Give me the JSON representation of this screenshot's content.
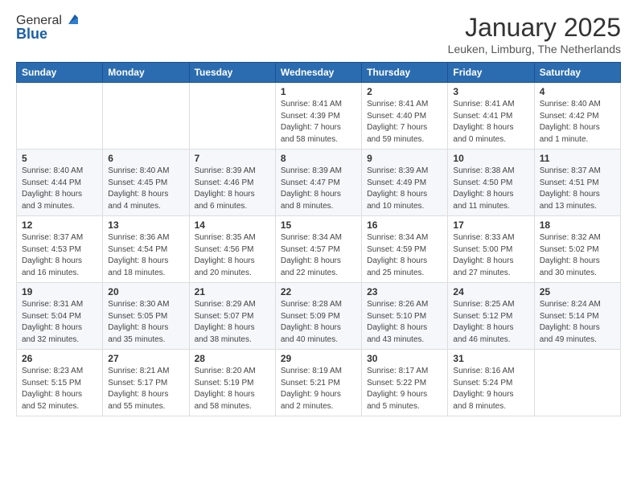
{
  "header": {
    "logo_general": "General",
    "logo_blue": "Blue",
    "month": "January 2025",
    "location": "Leuken, Limburg, The Netherlands"
  },
  "weekdays": [
    "Sunday",
    "Monday",
    "Tuesday",
    "Wednesday",
    "Thursday",
    "Friday",
    "Saturday"
  ],
  "weeks": [
    [
      {
        "day": "",
        "info": ""
      },
      {
        "day": "",
        "info": ""
      },
      {
        "day": "",
        "info": ""
      },
      {
        "day": "1",
        "info": "Sunrise: 8:41 AM\nSunset: 4:39 PM\nDaylight: 7 hours\nand 58 minutes."
      },
      {
        "day": "2",
        "info": "Sunrise: 8:41 AM\nSunset: 4:40 PM\nDaylight: 7 hours\nand 59 minutes."
      },
      {
        "day": "3",
        "info": "Sunrise: 8:41 AM\nSunset: 4:41 PM\nDaylight: 8 hours\nand 0 minutes."
      },
      {
        "day": "4",
        "info": "Sunrise: 8:40 AM\nSunset: 4:42 PM\nDaylight: 8 hours\nand 1 minute."
      }
    ],
    [
      {
        "day": "5",
        "info": "Sunrise: 8:40 AM\nSunset: 4:44 PM\nDaylight: 8 hours\nand 3 minutes."
      },
      {
        "day": "6",
        "info": "Sunrise: 8:40 AM\nSunset: 4:45 PM\nDaylight: 8 hours\nand 4 minutes."
      },
      {
        "day": "7",
        "info": "Sunrise: 8:39 AM\nSunset: 4:46 PM\nDaylight: 8 hours\nand 6 minutes."
      },
      {
        "day": "8",
        "info": "Sunrise: 8:39 AM\nSunset: 4:47 PM\nDaylight: 8 hours\nand 8 minutes."
      },
      {
        "day": "9",
        "info": "Sunrise: 8:39 AM\nSunset: 4:49 PM\nDaylight: 8 hours\nand 10 minutes."
      },
      {
        "day": "10",
        "info": "Sunrise: 8:38 AM\nSunset: 4:50 PM\nDaylight: 8 hours\nand 11 minutes."
      },
      {
        "day": "11",
        "info": "Sunrise: 8:37 AM\nSunset: 4:51 PM\nDaylight: 8 hours\nand 13 minutes."
      }
    ],
    [
      {
        "day": "12",
        "info": "Sunrise: 8:37 AM\nSunset: 4:53 PM\nDaylight: 8 hours\nand 16 minutes."
      },
      {
        "day": "13",
        "info": "Sunrise: 8:36 AM\nSunset: 4:54 PM\nDaylight: 8 hours\nand 18 minutes."
      },
      {
        "day": "14",
        "info": "Sunrise: 8:35 AM\nSunset: 4:56 PM\nDaylight: 8 hours\nand 20 minutes."
      },
      {
        "day": "15",
        "info": "Sunrise: 8:34 AM\nSunset: 4:57 PM\nDaylight: 8 hours\nand 22 minutes."
      },
      {
        "day": "16",
        "info": "Sunrise: 8:34 AM\nSunset: 4:59 PM\nDaylight: 8 hours\nand 25 minutes."
      },
      {
        "day": "17",
        "info": "Sunrise: 8:33 AM\nSunset: 5:00 PM\nDaylight: 8 hours\nand 27 minutes."
      },
      {
        "day": "18",
        "info": "Sunrise: 8:32 AM\nSunset: 5:02 PM\nDaylight: 8 hours\nand 30 minutes."
      }
    ],
    [
      {
        "day": "19",
        "info": "Sunrise: 8:31 AM\nSunset: 5:04 PM\nDaylight: 8 hours\nand 32 minutes."
      },
      {
        "day": "20",
        "info": "Sunrise: 8:30 AM\nSunset: 5:05 PM\nDaylight: 8 hours\nand 35 minutes."
      },
      {
        "day": "21",
        "info": "Sunrise: 8:29 AM\nSunset: 5:07 PM\nDaylight: 8 hours\nand 38 minutes."
      },
      {
        "day": "22",
        "info": "Sunrise: 8:28 AM\nSunset: 5:09 PM\nDaylight: 8 hours\nand 40 minutes."
      },
      {
        "day": "23",
        "info": "Sunrise: 8:26 AM\nSunset: 5:10 PM\nDaylight: 8 hours\nand 43 minutes."
      },
      {
        "day": "24",
        "info": "Sunrise: 8:25 AM\nSunset: 5:12 PM\nDaylight: 8 hours\nand 46 minutes."
      },
      {
        "day": "25",
        "info": "Sunrise: 8:24 AM\nSunset: 5:14 PM\nDaylight: 8 hours\nand 49 minutes."
      }
    ],
    [
      {
        "day": "26",
        "info": "Sunrise: 8:23 AM\nSunset: 5:15 PM\nDaylight: 8 hours\nand 52 minutes."
      },
      {
        "day": "27",
        "info": "Sunrise: 8:21 AM\nSunset: 5:17 PM\nDaylight: 8 hours\nand 55 minutes."
      },
      {
        "day": "28",
        "info": "Sunrise: 8:20 AM\nSunset: 5:19 PM\nDaylight: 8 hours\nand 58 minutes."
      },
      {
        "day": "29",
        "info": "Sunrise: 8:19 AM\nSunset: 5:21 PM\nDaylight: 9 hours\nand 2 minutes."
      },
      {
        "day": "30",
        "info": "Sunrise: 8:17 AM\nSunset: 5:22 PM\nDaylight: 9 hours\nand 5 minutes."
      },
      {
        "day": "31",
        "info": "Sunrise: 8:16 AM\nSunset: 5:24 PM\nDaylight: 9 hours\nand 8 minutes."
      },
      {
        "day": "",
        "info": ""
      }
    ]
  ]
}
